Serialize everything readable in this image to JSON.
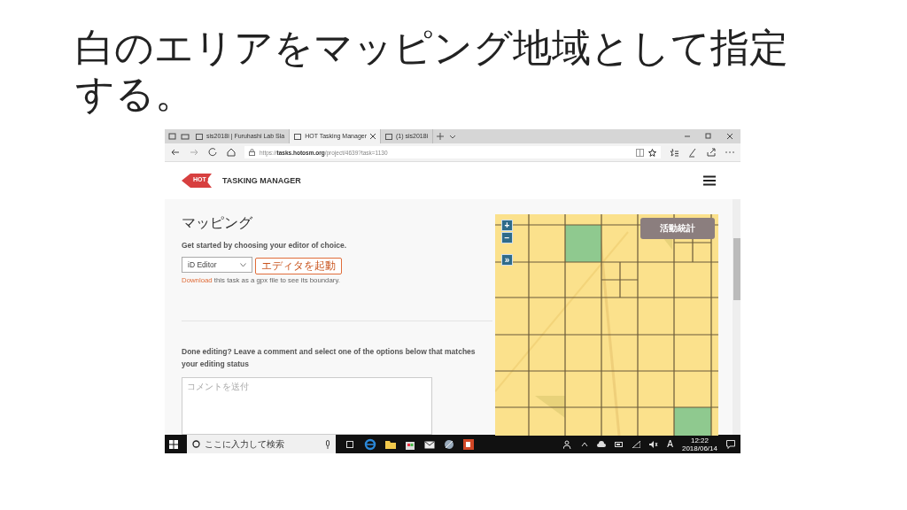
{
  "slide": {
    "title": "白のエリアをマッピング地域として指定する。"
  },
  "browser": {
    "tabs": [
      {
        "label": "sis2018i | Furuhashi Lab Sla",
        "selected": false
      },
      {
        "label": "HOT Tasking Manager",
        "selected": true
      },
      {
        "label": "(1) sis2018i",
        "selected": false
      }
    ],
    "url": "https://**tasks.hotosm.org**/project/4639?task=1130"
  },
  "site": {
    "logo_text": "HOT",
    "title": "TASKING MANAGER"
  },
  "mapping": {
    "heading": "マッピング",
    "intro": "Get started by choosing your editor of choice.",
    "editor_select": "iD Editor",
    "start_button": "エディタを起動",
    "download_link": "Download",
    "download_text": "this task as a gpx file to see its boundary.",
    "done_text": "Done editing? Leave a comment and select one of the options below that matches your editing status",
    "comment_placeholder": "コメントを送付"
  },
  "map": {
    "controls": [
      "+",
      "−",
      "»"
    ],
    "stats_button": "活動統計"
  },
  "taskbar": {
    "search_placeholder": "ここに入力して検索",
    "ime": "A",
    "time": "12:22",
    "date": "2018/06/14"
  }
}
